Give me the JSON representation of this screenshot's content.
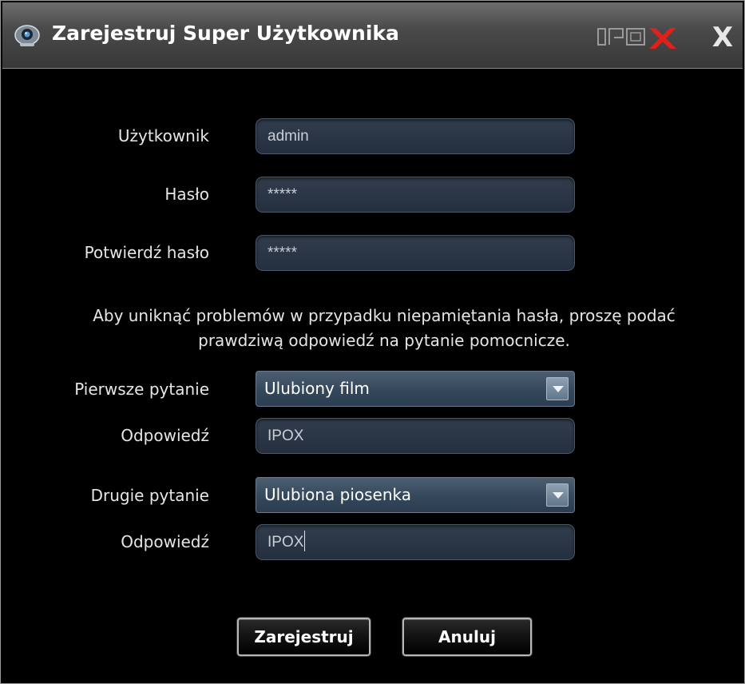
{
  "window": {
    "title": "Zarejestruj Super Użytkownika",
    "brand": "IPOX",
    "close_label": "X"
  },
  "form": {
    "user": {
      "label": "Użytkownik",
      "value": "admin"
    },
    "password": {
      "label": "Hasło",
      "value": "*****"
    },
    "confirm": {
      "label": "Potwierdź hasło",
      "value": "*****"
    },
    "info_line1": "Aby uniknąć problemów w przypadku niepamiętania hasła, proszę podać",
    "info_line2": "prawdziwą odpowiedź na pytanie pomocnicze.",
    "q1": {
      "label": "Pierwsze pytanie",
      "selected": "Ulubiony film"
    },
    "a1": {
      "label": "Odpowiedź",
      "value": "IPOX"
    },
    "q2": {
      "label": "Drugie pytanie",
      "selected": "Ulubiona piosenka"
    },
    "a2": {
      "label": "Odpowiedź",
      "value": "IPOX"
    }
  },
  "buttons": {
    "register": "Zarejestruj",
    "cancel": "Anuluj"
  },
  "colors": {
    "window_bg": "#000000",
    "field_bg": "#2a3646",
    "brand_red": "#e0201a"
  }
}
